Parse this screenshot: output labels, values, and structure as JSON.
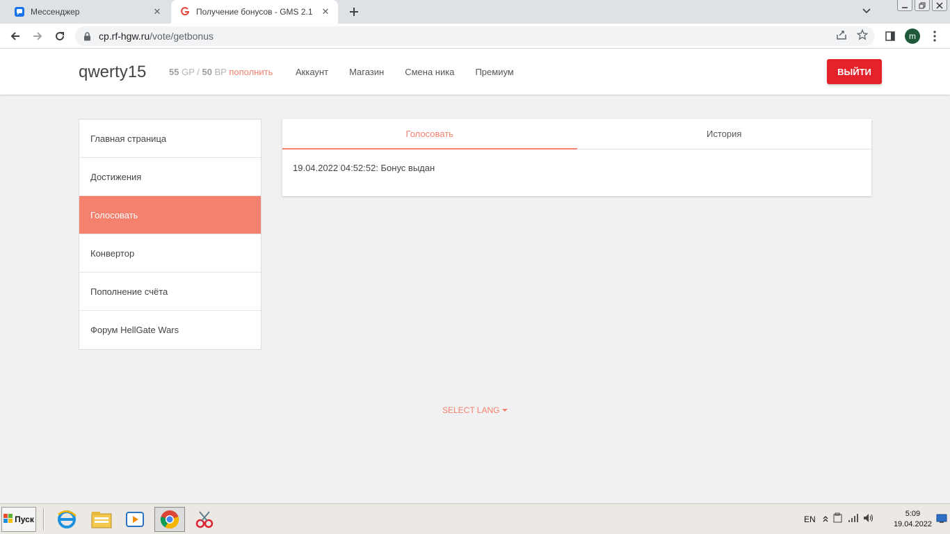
{
  "browser": {
    "tabs": [
      {
        "title": "Мессенджер",
        "active": false
      },
      {
        "title": "Получение бонусов - GMS 2.1",
        "active": true
      }
    ],
    "url_host": "cp.rf-hgw.ru",
    "url_path": "/vote/getbonus",
    "profile_initial": "m"
  },
  "header": {
    "username": "qwerty15",
    "gp_value": "55",
    "gp_unit": "GP",
    "separator": "/",
    "bp_value": "50",
    "bp_unit": "BP",
    "topup_label": "пополнить",
    "nav": [
      "Аккаунт",
      "Магазин",
      "Смена ника",
      "Премиум"
    ],
    "logout_label": "ВЫЙТИ"
  },
  "sidebar": {
    "items": [
      {
        "label": "Главная страница",
        "active": false
      },
      {
        "label": "Достижения",
        "active": false
      },
      {
        "label": "Голосовать",
        "active": true
      },
      {
        "label": "Конвертор",
        "active": false
      },
      {
        "label": "Пополнение счёта",
        "active": false
      },
      {
        "label": "Форум HellGate Wars",
        "active": false
      }
    ]
  },
  "card": {
    "tabs": [
      {
        "label": "Голосовать",
        "active": true
      },
      {
        "label": "История",
        "active": false
      }
    ],
    "message": "19.04.2022 04:52:52: Бонус выдан"
  },
  "footer": {
    "lang_label": "SELECT LANG"
  },
  "taskbar": {
    "start_label": "Пуск",
    "language": "EN",
    "time": "5:09",
    "date": "19.04.2022"
  },
  "colors": {
    "accent": "#f4806e",
    "logout": "#e52229",
    "page_bg": "#f1f1f1"
  }
}
